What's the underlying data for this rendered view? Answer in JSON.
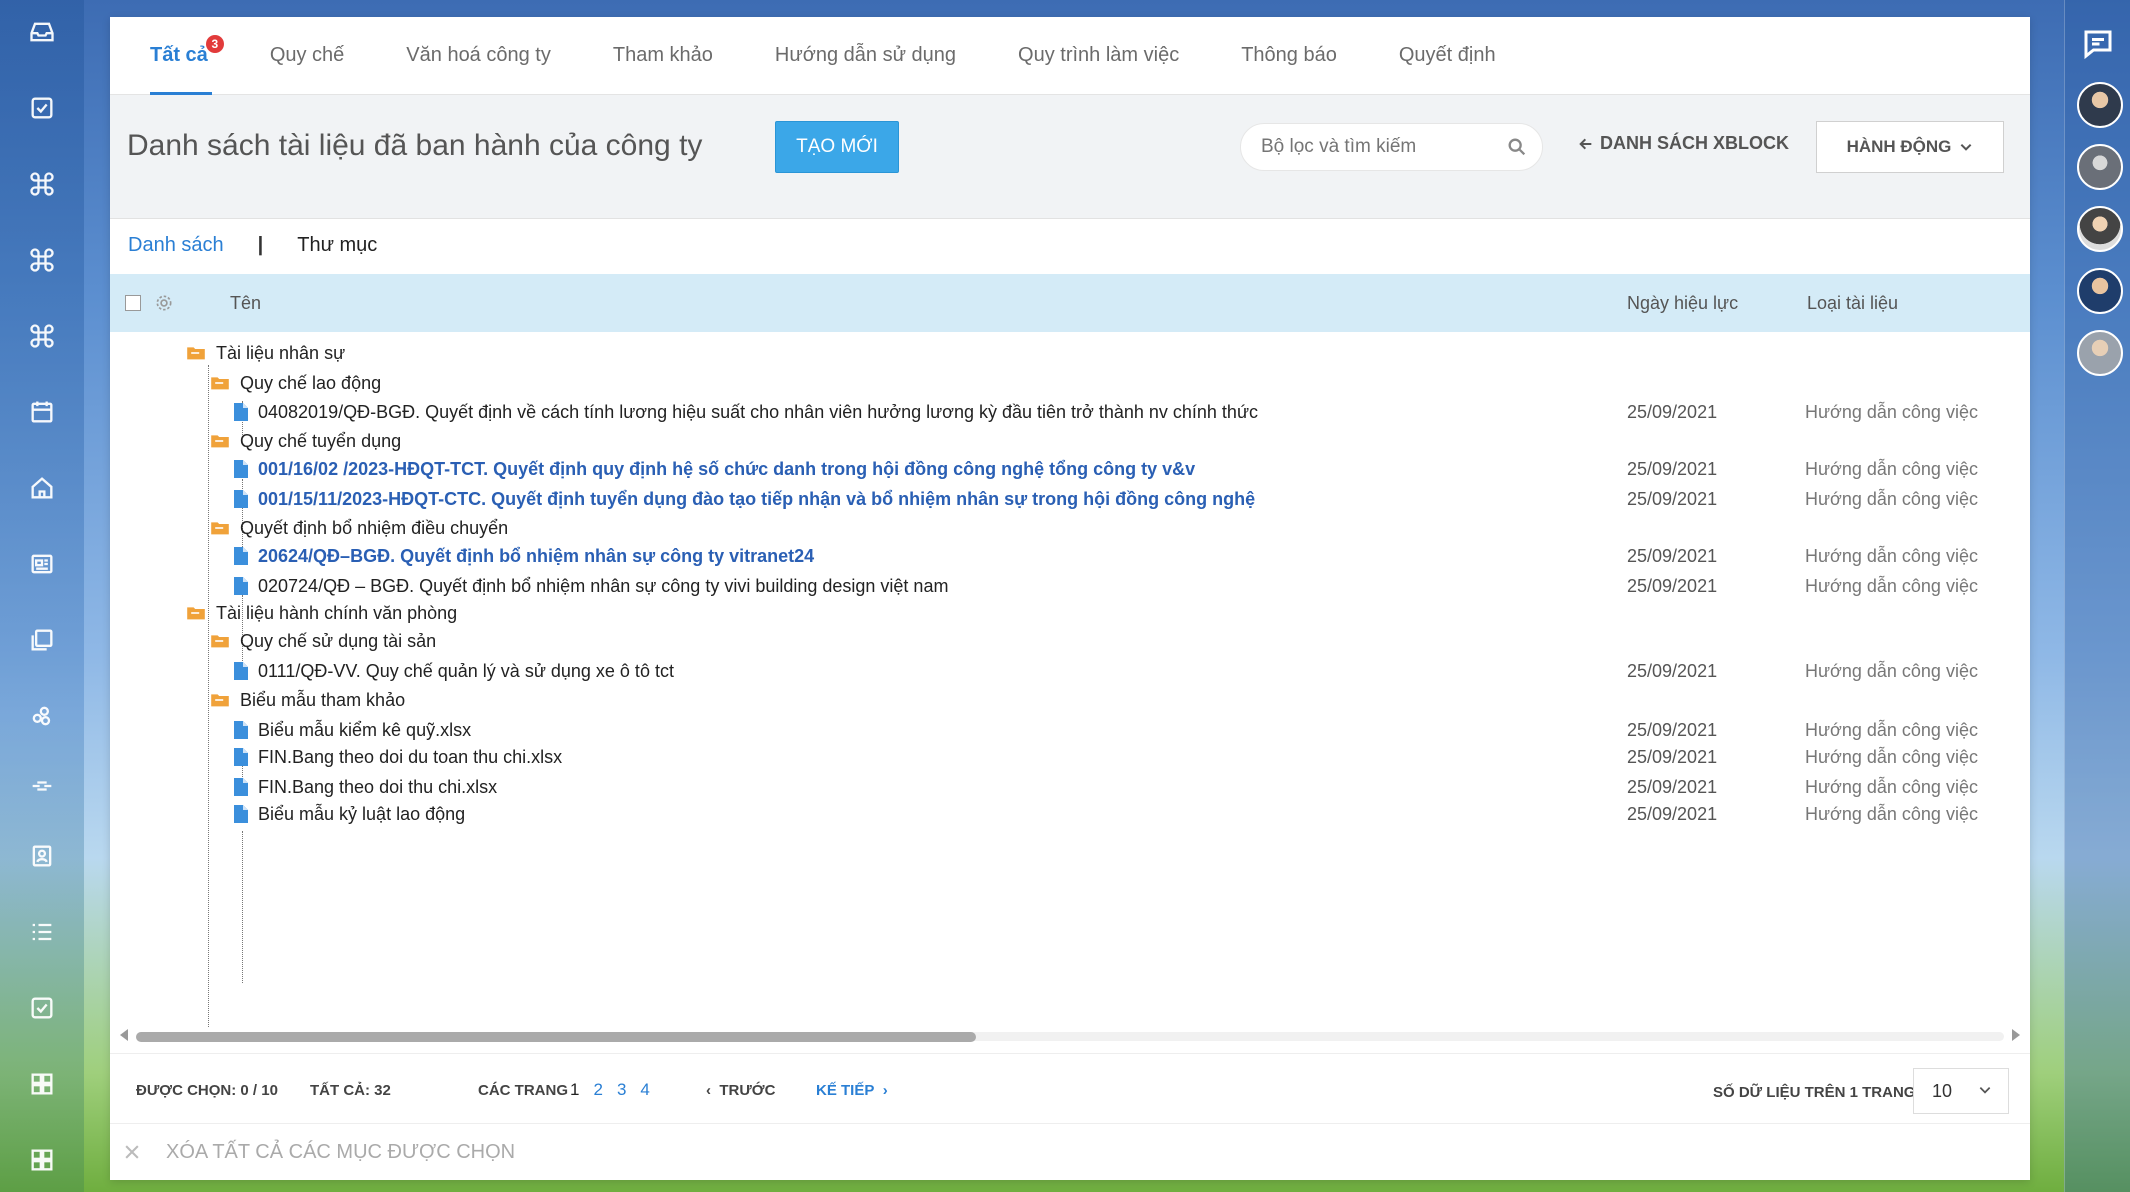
{
  "tabs": [
    {
      "label": "Tất cả",
      "badge": "3",
      "active": true
    },
    {
      "label": "Quy chế"
    },
    {
      "label": "Văn hoá công ty"
    },
    {
      "label": "Tham khảo"
    },
    {
      "label": "Hướng dẫn sử dụng"
    },
    {
      "label": "Quy trình làm việc"
    },
    {
      "label": "Thông báo"
    },
    {
      "label": "Quyết định"
    }
  ],
  "header": {
    "title": "Danh sách tài liệu đã ban hành của công ty",
    "create_label": "TẠO MỚI",
    "search_placeholder": "Bộ lọc và tìm kiếm",
    "xblock_label": "DANH SÁCH XBLOCK",
    "actions_label": "HÀNH ĐỘNG"
  },
  "view_switch": {
    "list": "Danh sách",
    "separator": "|",
    "folder": "Thư mục"
  },
  "columns": {
    "name": "Tên",
    "date": "Ngày hiệu lực",
    "type": "Loại tài liệu"
  },
  "rows": [
    {
      "kind": "folder",
      "level": 0,
      "name": "Tài liệu nhân sự",
      "date": "",
      "type": ""
    },
    {
      "kind": "folder",
      "level": 1,
      "name": "Quy chế lao động",
      "date": "",
      "type": ""
    },
    {
      "kind": "file",
      "level": 2,
      "link": false,
      "name": "04082019/QĐ-BGĐ. Quyết định về cách tính lương hiệu suất cho nhân viên hưởng lương kỳ đầu tiên trở thành nv chính thức",
      "date": "25/09/2021",
      "type": "Hướng dẫn công việc"
    },
    {
      "kind": "folder",
      "level": 1,
      "name": "Quy chế tuyển dụng",
      "date": "",
      "type": ""
    },
    {
      "kind": "file",
      "level": 2,
      "link": true,
      "name": "001/16/02 /2023-HĐQT-TCT. Quyết định quy định hệ số chức danh trong hội đồng công nghệ tổng công ty v&v",
      "date": "25/09/2021",
      "type": "Hướng dẫn công việc"
    },
    {
      "kind": "file",
      "level": 2,
      "link": true,
      "name": "001/15/11/2023-HĐQT-CTC. Quyết định tuyển dụng đào tạo tiếp nhận và bổ nhiệm nhân sự trong hội đồng công nghệ",
      "date": "25/09/2021",
      "type": "Hướng dẫn công việc"
    },
    {
      "kind": "folder",
      "level": 1,
      "name": "Quyết định bổ nhiệm điều chuyển",
      "date": "",
      "type": ""
    },
    {
      "kind": "file",
      "level": 2,
      "link": true,
      "name": "20624/QĐ–BGĐ. Quyết định bổ nhiệm nhân sự công ty vitranet24",
      "date": "25/09/2021",
      "type": "Hướng dẫn công việc"
    },
    {
      "kind": "file",
      "level": 2,
      "link": false,
      "name": "020724/QĐ – BGĐ. Quyết định bổ nhiệm nhân sự công ty vivi building design việt nam",
      "date": "25/09/2021",
      "type": "Hướng dẫn công việc"
    },
    {
      "kind": "folder",
      "level": 0,
      "name": "Tài liệu hành chính văn phòng",
      "date": "",
      "type": ""
    },
    {
      "kind": "folder",
      "level": 1,
      "name": "Quy chế sử dụng tài sản",
      "date": "",
      "type": ""
    },
    {
      "kind": "file",
      "level": 2,
      "link": false,
      "name": "0111/QĐ-VV. Quy chế quản lý và sử dụng xe ô tô tct",
      "date": "25/09/2021",
      "type": "Hướng dẫn công việc"
    },
    {
      "kind": "folder",
      "level": 1,
      "name": "Biểu mẫu tham khảo",
      "date": "",
      "type": ""
    },
    {
      "kind": "file",
      "level": 2,
      "link": false,
      "name": "Biểu mẫu kiểm kê quỹ.xlsx",
      "date": "25/09/2021",
      "type": "Hướng dẫn công việc"
    },
    {
      "kind": "file",
      "level": 2,
      "link": false,
      "name": "FIN.Bang theo doi du toan thu chi.xlsx",
      "date": "25/09/2021",
      "type": "Hướng dẫn công việc"
    },
    {
      "kind": "file",
      "level": 2,
      "link": false,
      "name": "FIN.Bang theo doi thu chi.xlsx",
      "date": "25/09/2021",
      "type": "Hướng dẫn công việc"
    },
    {
      "kind": "file",
      "level": 2,
      "link": false,
      "name": "Biểu mẫu kỷ luật lao động",
      "date": "25/09/2021",
      "type": "Hướng dẫn công việc"
    }
  ],
  "footer": {
    "selected": "ĐƯỢC CHỌN: 0 / 10",
    "total": "TẤT CẢ: 32",
    "pages_label": "CÁC TRANG",
    "pages": [
      "1",
      "2",
      "3",
      "4"
    ],
    "prev": "TRƯỚC",
    "next": "KẾ TIẾP",
    "per_page_label": "SỐ DỮ LIỆU TRÊN 1 TRANG:",
    "per_page_value": "10"
  },
  "bulk": {
    "delete_label": "XÓA TẤT CẢ CÁC MỤC ĐƯỢC CHỌN"
  },
  "colors": {
    "accent": "#2a7fd4",
    "create_button": "#3ba7e8",
    "table_header": "#d4ebf7",
    "folder": "#f0a23a",
    "file": "#3b8fdc",
    "badge": "#e23b3b"
  }
}
